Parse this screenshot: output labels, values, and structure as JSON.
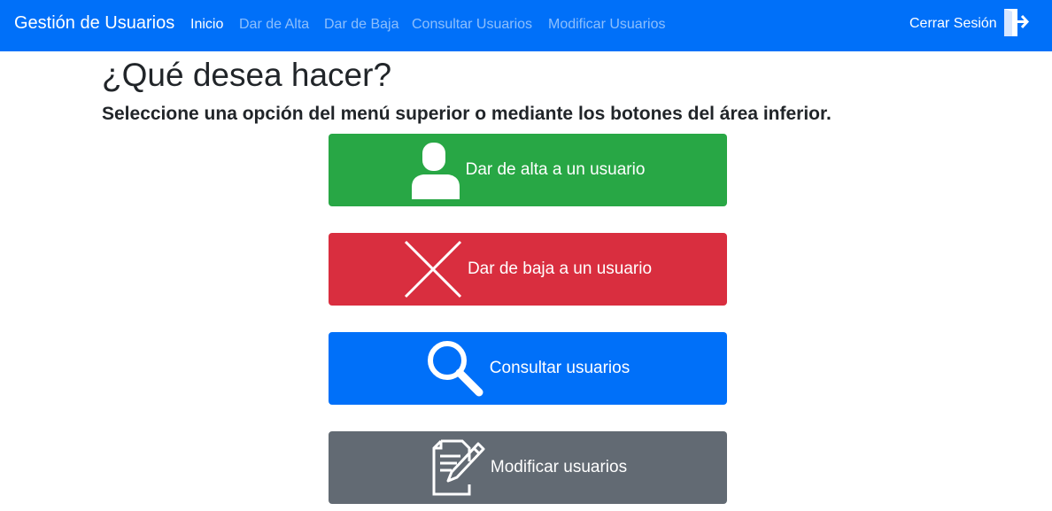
{
  "navbar": {
    "brand": "Gestión de Usuarios",
    "links": [
      {
        "label": "Inicio",
        "active": true
      },
      {
        "label": "Dar de Alta",
        "active": false
      },
      {
        "label": "Dar de Baja",
        "active": false
      },
      {
        "label": "Consultar Usuarios",
        "active": false
      },
      {
        "label": "Modificar Usuarios",
        "active": false
      }
    ],
    "logout": {
      "label": "Cerrar Sesión",
      "icon": "logout-door-icon"
    }
  },
  "main": {
    "heading": "¿Qué desea hacer?",
    "subheading": "Seleccione una opción del menú superior o mediante los botones del área inferior.",
    "actions": [
      {
        "label": "Dar de alta a un usuario",
        "icon": "user-icon",
        "color": "#28a745"
      },
      {
        "label": "Dar de baja a un usuario",
        "icon": "x-cross-icon",
        "color": "#d92e3f"
      },
      {
        "label": "Consultar usuarios",
        "icon": "magnifier-icon",
        "color": "#0070f9"
      },
      {
        "label": "Modificar usuarios",
        "icon": "edit-document-icon",
        "color": "#626a73"
      }
    ]
  },
  "colors": {
    "navbar_bg": "#0070f9",
    "text": "#212529"
  }
}
